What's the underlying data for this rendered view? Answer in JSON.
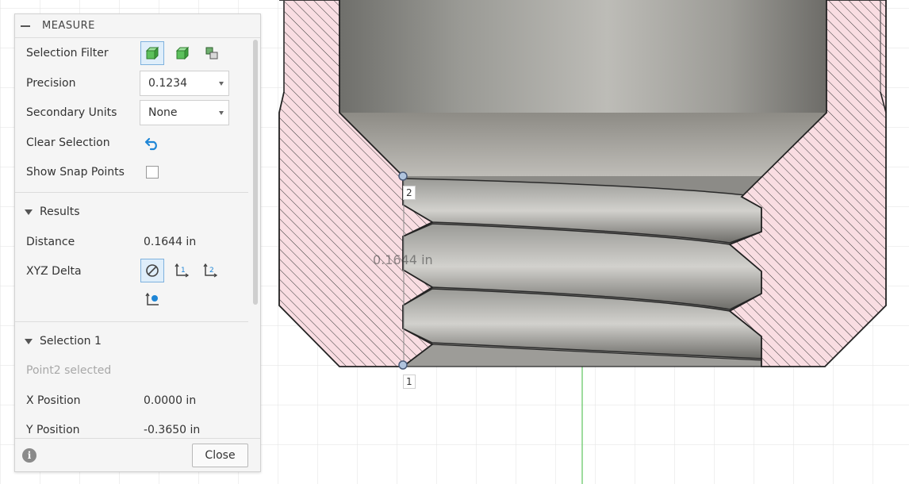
{
  "panel": {
    "title": "MEASURE",
    "selection_filter": {
      "label": "Selection Filter",
      "icons": [
        "select-body-icon",
        "select-face-icon",
        "select-component-icon"
      ]
    },
    "precision": {
      "label": "Precision",
      "value": "0.1234"
    },
    "secondary_units": {
      "label": "Secondary Units",
      "value": "None"
    },
    "clear_selection": {
      "label": "Clear Selection"
    },
    "show_snap_points": {
      "label": "Show Snap Points",
      "checked": false
    },
    "results": {
      "heading": "Results",
      "distance": {
        "label": "Distance",
        "value": "0.1644 in"
      },
      "xyz_delta": {
        "label": "XYZ Delta",
        "icons": [
          "no-delta-icon",
          "delta-axis-1-icon",
          "delta-axis-2-icon",
          "delta-axis-3-icon"
        ]
      }
    },
    "selection1": {
      "heading": "Selection 1",
      "status": "Point2 selected",
      "x_position": {
        "label": "X Position",
        "value": "0.0000 in"
      },
      "y_position": {
        "label": "Y Position",
        "value": "-0.3650 in"
      }
    },
    "footer": {
      "info": "i",
      "close_label": "Close"
    }
  },
  "viewport": {
    "dimension_label": "0.1644 in",
    "point_labels": [
      "2",
      "1"
    ],
    "colors": {
      "section_fill": "#f9dde2",
      "hatch": "#333333",
      "grid": "#dcdcdc",
      "axis": "#7ed07e",
      "accent": "#1f86d6"
    }
  }
}
